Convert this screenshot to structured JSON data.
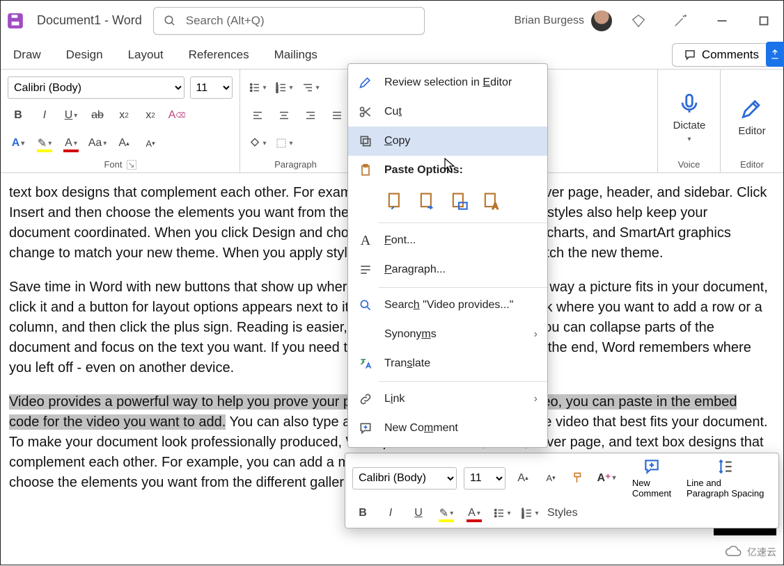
{
  "titlebar": {
    "doc_title": "Document1  -  Word",
    "search_placeholder": "Search (Alt+Q)",
    "user_name": "Brian Burgess"
  },
  "tabs": {
    "items": [
      "Draw",
      "Design",
      "Layout",
      "References",
      "Mailings"
    ],
    "comments_label": "Comments"
  },
  "ribbon": {
    "font_group_label": "Font",
    "paragraph_group_label": "Paragraph",
    "voice_label": "Voice",
    "editor_label": "Editor",
    "dictate_label": "Dictate",
    "editor_btn_label": "Editor",
    "font_name": "Calibri (Body)",
    "font_size": "11"
  },
  "context_menu": {
    "review": "Review selection in Editor",
    "cut": "Cut",
    "copy": "Copy",
    "paste_options": "Paste Options:",
    "font": "Font...",
    "paragraph": "Paragraph...",
    "search": "Search \"Video provides...\"",
    "synonyms": "Synonyms",
    "translate": "Translate",
    "link": "Link",
    "new_comment": "New Comment"
  },
  "mini": {
    "font_name": "Calibri (Body)",
    "font_size": "11",
    "styles": "Styles",
    "new_comment_l1": "New",
    "new_comment_l2": "Comment",
    "spacing_l1": "Line and",
    "spacing_l2": "Paragraph Spacing"
  },
  "document": {
    "p1": "text box designs that complement each other. For example, you can add a matching cover page, header, and sidebar. Click Insert and then choose the elements you want from the different galleries. Themes and styles also help keep your document coordinated. When you click Design and choose a new Theme, the pictures, charts, and SmartArt graphics change to match your new theme. When you apply styles, your headings change to match the new theme.",
    "p2": "Save time in Word with new buttons that show up where you need them. To change the way a picture fits in your document, click it and a button for layout options appears next to it. When you work on a table, click where you want to add a row or a column, and then click the plus sign. Reading is easier, too, in the new Reading view. You can collapse parts of the document and focus on the text you want. If you need to stop reading before you reach the end, Word remembers where you left off - even on another device.",
    "p3_sel": "Video provides a powerful way to help you prove your point. When you click Online Video, you can paste in the embed code for the video you want to add.",
    "p3_rest": " You can also type a keyword to search online for the video that best fits your document. To make your document look professionally produced, Word provides header, footer, cover page, and text box designs that complement each other. For example, you can add a matching cover page, header, and sidebar. Click Insert and then choose the elements you want from the different galleries."
  },
  "watermark": "亿速云"
}
